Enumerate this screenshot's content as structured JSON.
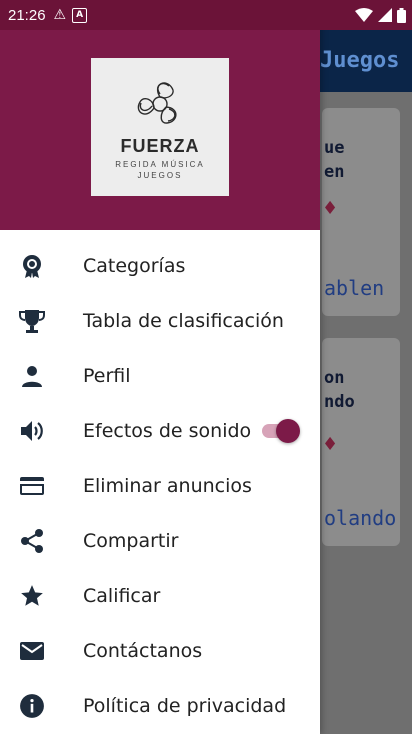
{
  "status_bar": {
    "time": "21:26"
  },
  "background_app": {
    "title": "Juegos",
    "cards": [
      {
        "text_lines": [
          "ue",
          "en"
        ],
        "bottom": "ablen"
      },
      {
        "text_lines": [
          "on",
          "ndo"
        ],
        "bottom": "olando"
      }
    ]
  },
  "drawer": {
    "logo": {
      "brand": "FUERZA",
      "subtitle_line1": "REGIDA MÚSICA",
      "subtitle_line2": "JUEGOS"
    },
    "items": [
      {
        "label": "Categorías",
        "icon": "gear-badge-icon"
      },
      {
        "label": "Tabla de clasificación",
        "icon": "trophy-icon"
      },
      {
        "label": "Perfil",
        "icon": "person-icon"
      },
      {
        "label": "Efectos de sonido",
        "icon": "volume-icon",
        "toggle_on": true
      },
      {
        "label": "Eliminar anuncios",
        "icon": "credit-card-icon"
      },
      {
        "label": "Compartir",
        "icon": "share-icon"
      },
      {
        "label": "Calificar",
        "icon": "star-icon"
      },
      {
        "label": "Contáctanos",
        "icon": "mail-icon"
      },
      {
        "label": "Política de privacidad",
        "icon": "info-icon"
      }
    ]
  },
  "colors": {
    "primary": "#7c1a48",
    "status_bar": "#6b1338",
    "icon": "#1f2d3d"
  }
}
